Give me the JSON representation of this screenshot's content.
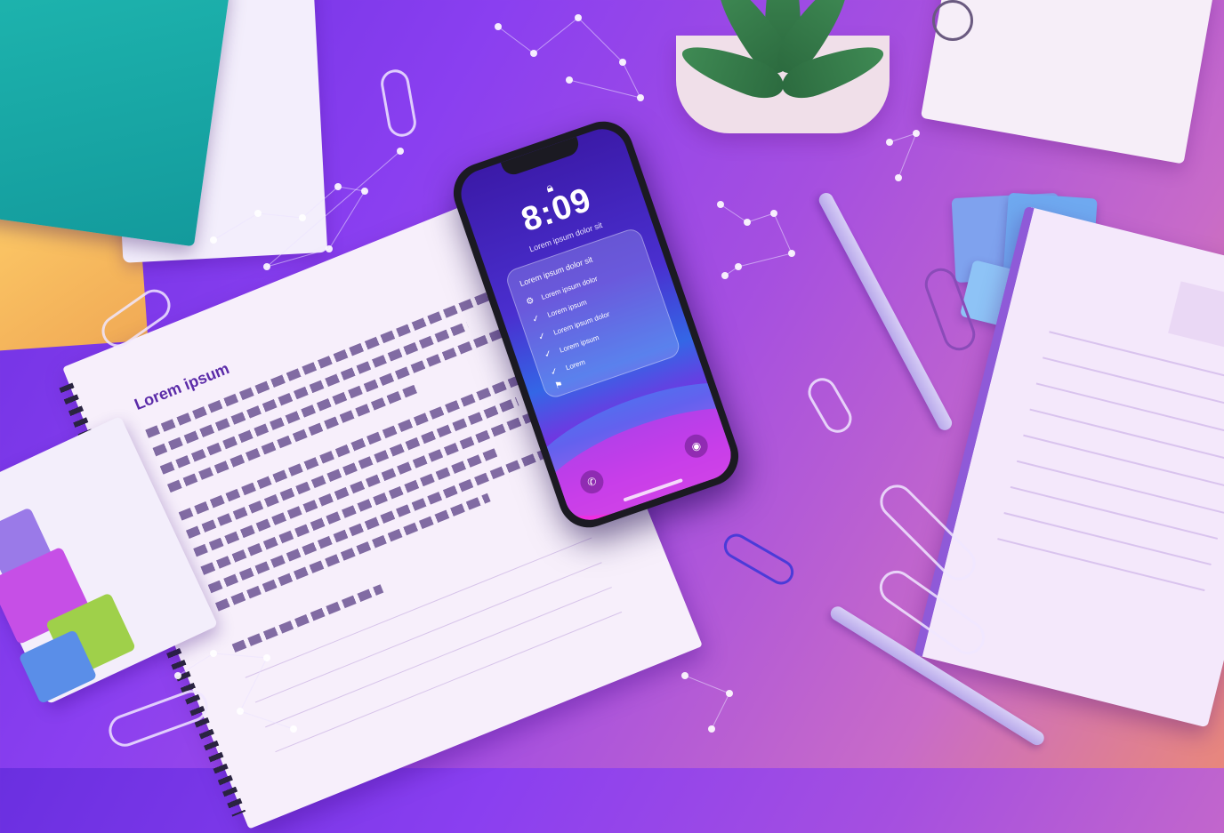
{
  "phone": {
    "time": "8:09",
    "date_line": "Lorem ipsum dolor sit",
    "widget": {
      "title": "Lorem ipsum dolor sit",
      "rows": [
        {
          "icon": "gear-icon",
          "glyph": "⚙",
          "text": "Lorem ipsum dolor"
        },
        {
          "icon": "check-icon",
          "glyph": "✓",
          "text": "Lorem ipsum"
        },
        {
          "icon": "check-icon",
          "glyph": "✓",
          "text": "Lorem ipsum dolor"
        },
        {
          "icon": "check-icon",
          "glyph": "✓",
          "text": "Lorem ipsum"
        },
        {
          "icon": "check-icon",
          "glyph": "✓",
          "text": "Lorem"
        },
        {
          "icon": "bell-icon",
          "glyph": "⚑",
          "text": ""
        }
      ]
    },
    "left_button_glyph": "✆",
    "right_button_glyph": "◉"
  },
  "notebook": {
    "heading": "Lorem ipsum"
  },
  "colors": {
    "background_start": "#6a2fe0",
    "background_end": "#e8877c",
    "accent_purple": "#8a3ff0",
    "screen_magenta": "#ff3bd8",
    "teal_book": "#1fb7b0"
  }
}
